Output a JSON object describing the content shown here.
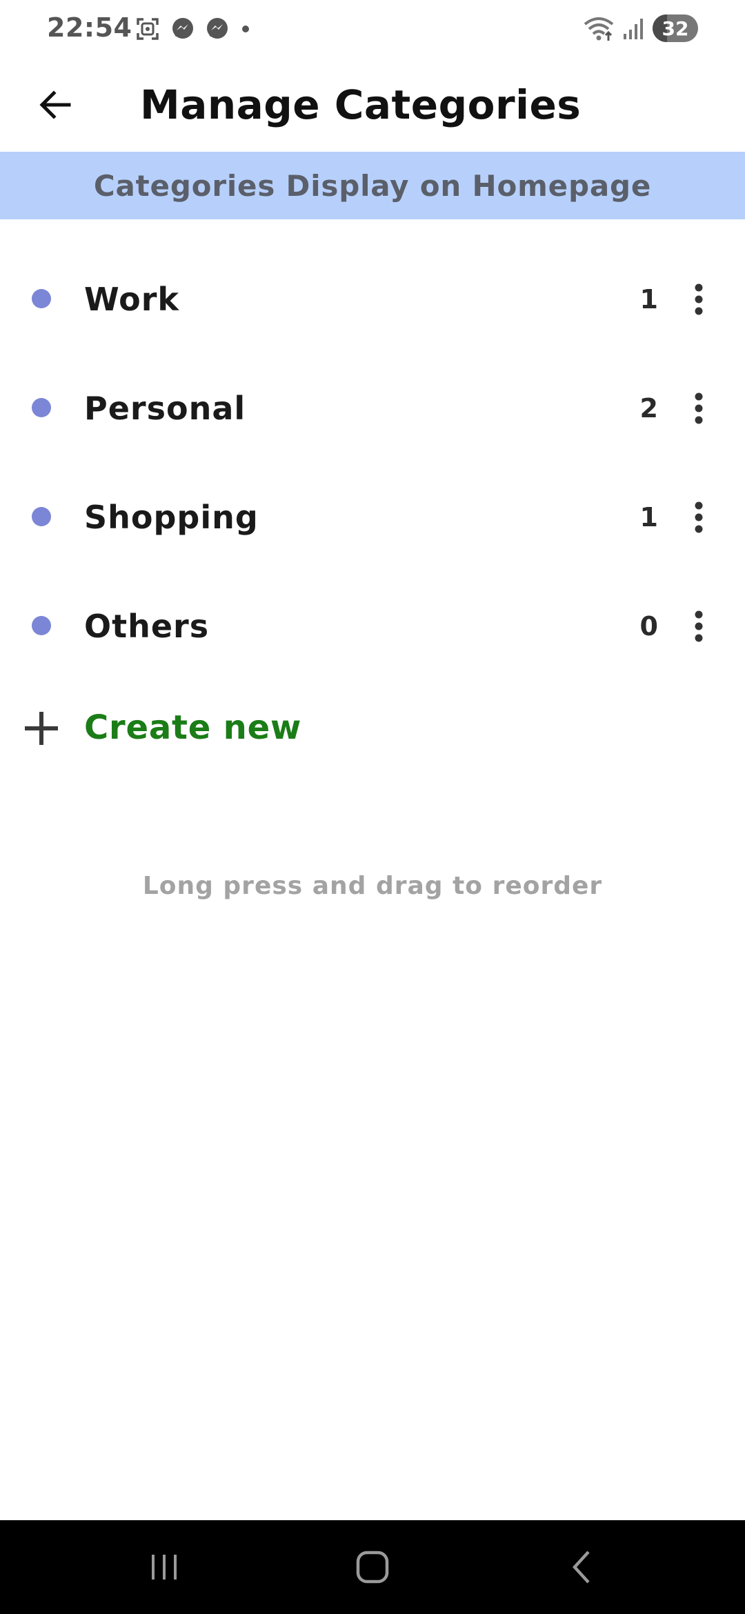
{
  "status_bar": {
    "time": "22:54",
    "battery": "32",
    "battery_level": 0.32,
    "left_icons": [
      "screenshot-icon",
      "messenger-icon",
      "messenger-icon",
      "dot-icon"
    ],
    "right_icons": [
      "wifi-icon",
      "signal-icon",
      "battery-icon"
    ]
  },
  "app_bar": {
    "title": "Manage Categories",
    "back_icon": "arrow-left-icon"
  },
  "banner": {
    "text": "Categories Display on Homepage",
    "background": "#b7d0fb"
  },
  "categories": [
    {
      "name": "Work",
      "count": "1"
    },
    {
      "name": "Personal",
      "count": "2"
    },
    {
      "name": "Shopping",
      "count": "1"
    },
    {
      "name": "Others",
      "count": "0"
    }
  ],
  "dot_color": "#7b86d6",
  "create_new": {
    "label": "Create new",
    "color": "#1b7d17",
    "icon": "plus-icon"
  },
  "hint": "Long press and drag to reorder",
  "nav_bar": {
    "buttons": [
      "recent-apps-icon",
      "home-icon",
      "back-icon"
    ]
  }
}
